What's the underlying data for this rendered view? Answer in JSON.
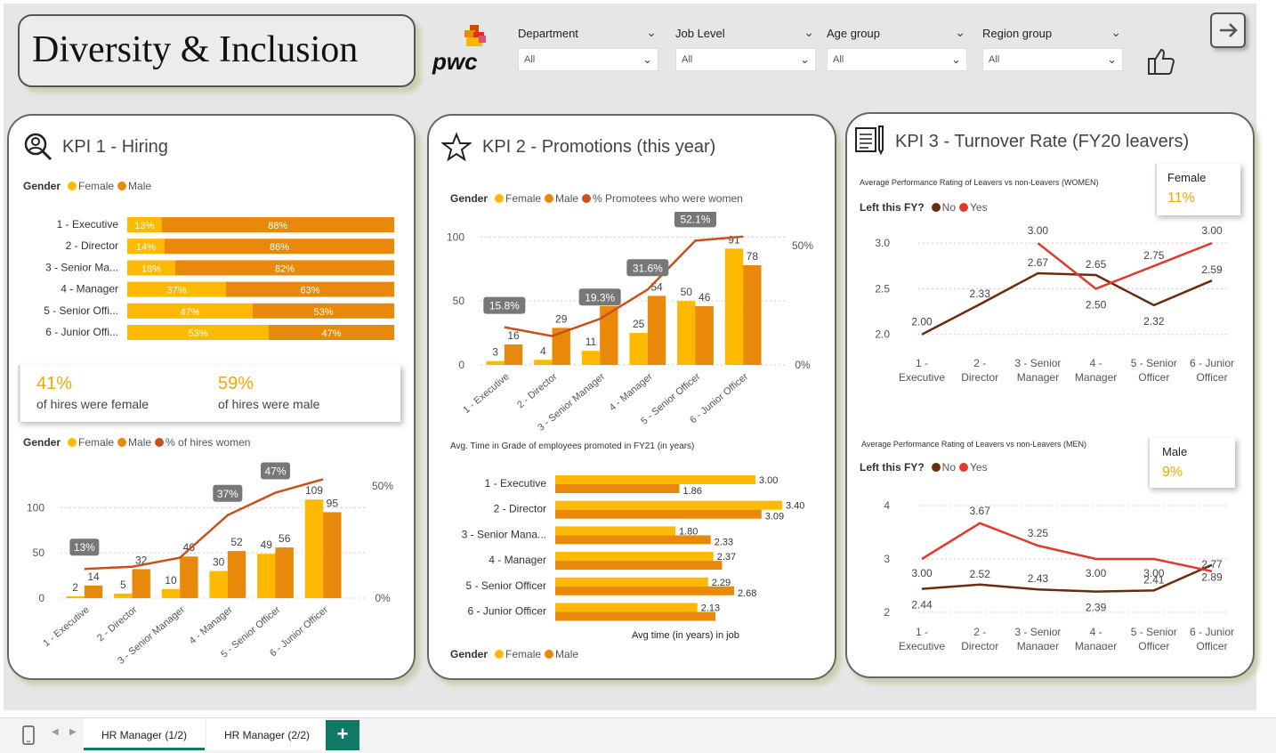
{
  "header": {
    "title": "Diversity & Inclusion",
    "logo_text": "pwc"
  },
  "filters": [
    {
      "label": "Department",
      "value": "All"
    },
    {
      "label": "Job Level",
      "value": "All"
    },
    {
      "label": "Age group",
      "value": "All"
    },
    {
      "label": "Region group",
      "value": "All"
    }
  ],
  "icons": {
    "thumb": "thumbs-up-icon",
    "nav": "arrow-right-icon",
    "kpi1": "search-person-icon",
    "kpi2": "star-icon",
    "kpi3": "document-pen-icon",
    "mobile": "phone-icon"
  },
  "colors": {
    "female": "#FFB900",
    "male": "#E8890B",
    "pct_women": "#C9501A",
    "no": "#6B2B0E",
    "yes": "#E03A2E",
    "accent_green": "#117865"
  },
  "kpi1": {
    "title": "KPI 1 - Hiring",
    "legend": {
      "title": "Gender",
      "female": "Female",
      "male": "Male",
      "pct": "% of hires women"
    },
    "stats": {
      "female_value": "41%",
      "female_label": "of hires were female",
      "male_value": "59%",
      "male_label": "of hires were male"
    }
  },
  "kpi2": {
    "title": "KPI 2 - Promotions (this year)",
    "legend": {
      "title": "Gender",
      "female": "Female",
      "male": "Male",
      "pct": "% Promotees who were women"
    },
    "time_title": "Avg. Time in Grade of employees promoted in FY21 (in years)",
    "time_xlabel": "Avg time (in years) in job"
  },
  "kpi3": {
    "title": "KPI 3 - Turnover Rate (FY20 leavers)",
    "women_title": "Average Performance Rating of Leavers vs non-Leavers (WOMEN)",
    "men_title": "Average Performance Rating of Leavers vs non-Leavers (MEN)",
    "legend": {
      "title": "Left this FY?",
      "no": "No",
      "yes": "Yes"
    },
    "female_card": {
      "label": "Female",
      "value": "11%"
    },
    "male_card": {
      "label": "Male",
      "value": "9%"
    }
  },
  "chart_data": [
    {
      "id": "hiring_split",
      "type": "bar",
      "stacked": "100%",
      "orientation": "horizontal",
      "categories": [
        "1 - Executive",
        "2 - Director",
        "3 - Senior Ma...",
        "4 - Manager",
        "5 - Senior Offi...",
        "6 - Junior Offi..."
      ],
      "series": [
        {
          "name": "Female",
          "values": [
            13,
            14,
            18,
            37,
            47,
            53
          ]
        },
        {
          "name": "Male",
          "values": [
            88,
            86,
            82,
            63,
            53,
            47
          ]
        }
      ]
    },
    {
      "id": "hires",
      "type": "bar",
      "categories": [
        "1 - Executive",
        "2 - Director",
        "3 - Senior Manager",
        "4 - Manager",
        "5 - Senior Officer",
        "6 - Junior Officer"
      ],
      "series": [
        {
          "name": "Female",
          "values": [
            2,
            5,
            10,
            30,
            49,
            109
          ]
        },
        {
          "name": "Male",
          "values": [
            14,
            32,
            46,
            52,
            56,
            95
          ]
        },
        {
          "name": "% of hires women",
          "type": "line",
          "values": [
            13,
            14,
            18,
            37,
            47,
            53
          ],
          "labels": [
            "13%",
            "",
            "",
            "37%",
            "47%",
            ""
          ]
        }
      ],
      "ylim": [
        0,
        120
      ],
      "y2ticks": [
        "0%",
        "50%"
      ],
      "yticks": [
        0,
        50,
        100
      ]
    },
    {
      "id": "promotions",
      "type": "bar",
      "categories": [
        "1 - Executive",
        "2 - Director",
        "3 - Senior Manager",
        "4 - Manager",
        "5 - Senior Officer",
        "6 - Junior Officer"
      ],
      "series": [
        {
          "name": "Female",
          "values": [
            3,
            4,
            11,
            25,
            50,
            91
          ]
        },
        {
          "name": "Male",
          "values": [
            16,
            29,
            46,
            54,
            46,
            78
          ]
        },
        {
          "name": "% Promotees who were women",
          "type": "line",
          "values": [
            15.8,
            12.1,
            19.3,
            31.6,
            52.1,
            53.8
          ],
          "labels": [
            "15.8%",
            "",
            "19.3%",
            "31.6%",
            "52.1%",
            ""
          ]
        }
      ],
      "ylim": [
        0,
        110
      ],
      "y2ticks": [
        "0%",
        "50%"
      ],
      "yticks": [
        0,
        50,
        100
      ]
    },
    {
      "id": "time_in_grade",
      "type": "bar",
      "orientation": "horizontal",
      "categories": [
        "1 - Executive",
        "2 - Director",
        "3 - Senior Mana...",
        "4 - Manager",
        "5 - Senior Officer",
        "6 - Junior Officer"
      ],
      "series": [
        {
          "name": "Female",
          "values": [
            3.0,
            3.4,
            1.8,
            2.37,
            2.29,
            2.13
          ]
        },
        {
          "name": "Male",
          "values": [
            1.86,
            3.09,
            2.33,
            null,
            2.68,
            null
          ]
        }
      ],
      "xlabel": "Avg time (in years) in job"
    },
    {
      "id": "women_rating",
      "type": "line",
      "categories": [
        "1 - Executive",
        "2 - Director",
        "3 - Senior Manager",
        "4 - Manager",
        "5 - Senior Officer",
        "6 - Junior Officer"
      ],
      "xlabels": [
        [
          "1 -",
          "Executive"
        ],
        [
          "2 -",
          "Director"
        ],
        [
          "3 - Senior",
          "Manager"
        ],
        [
          "4 -",
          "Manager"
        ],
        [
          "5 - Senior",
          "Officer"
        ],
        [
          "6 - Junior",
          "Officer"
        ]
      ],
      "series": [
        {
          "name": "No",
          "values": [
            2.0,
            2.33,
            2.67,
            2.65,
            2.32,
            2.59
          ]
        },
        {
          "name": "Yes",
          "values": [
            null,
            null,
            3.0,
            2.5,
            2.75,
            3.0
          ]
        }
      ],
      "ylim": [
        1.9,
        3.05
      ],
      "yticks": [
        "2.0",
        "2.5",
        "3.0"
      ]
    },
    {
      "id": "men_rating",
      "type": "line",
      "categories": [
        "1 - Executive",
        "2 - Director",
        "3 - Senior Manager",
        "4 - Manager",
        "5 - Senior Officer",
        "6 - Junior Officer"
      ],
      "xlabels": [
        [
          "1 -",
          "Executive"
        ],
        [
          "2 -",
          "Director"
        ],
        [
          "3 - Senior",
          "Manager"
        ],
        [
          "4 -",
          "Manager"
        ],
        [
          "5 - Senior",
          "Officer"
        ],
        [
          "6 - Junior",
          "Officer"
        ]
      ],
      "series": [
        {
          "name": "No",
          "values": [
            2.44,
            2.52,
            2.43,
            2.39,
            2.41,
            2.89
          ]
        },
        {
          "name": "Yes",
          "values": [
            3.0,
            3.67,
            3.25,
            3.0,
            3.0,
            2.77
          ]
        }
      ],
      "ylim": [
        2,
        4.2
      ],
      "yticks": [
        "2",
        "3",
        "4"
      ]
    }
  ],
  "tabs": [
    {
      "label": "HR Manager (1/2)"
    },
    {
      "label": "HR Manager (2/2)"
    }
  ],
  "add_tab": "+"
}
